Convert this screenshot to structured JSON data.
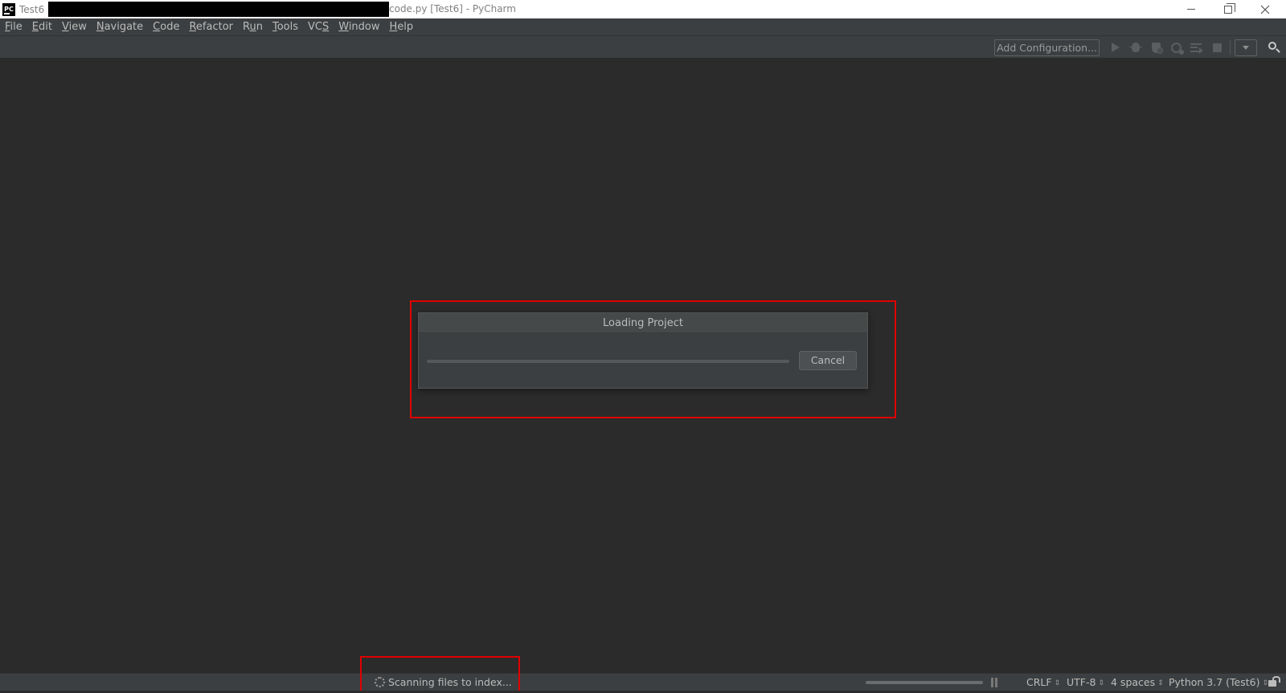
{
  "window": {
    "project_name": "Test6",
    "title_rest": "code.py [Test6] - PyCharm",
    "logo_text": "PC"
  },
  "menu": [
    {
      "label": "File",
      "mnemonic": "F",
      "rest": "ile"
    },
    {
      "label": "Edit",
      "mnemonic": "E",
      "rest": "dit"
    },
    {
      "label": "View",
      "mnemonic": "V",
      "rest": "iew"
    },
    {
      "label": "Navigate",
      "mnemonic": "N",
      "rest": "avigate"
    },
    {
      "label": "Code",
      "mnemonic": "C",
      "rest": "ode"
    },
    {
      "label": "Refactor",
      "mnemonic": "R",
      "rest": "efactor"
    },
    {
      "label": "Run",
      "mnemonic": "u",
      "pre": "R",
      "rest": "n"
    },
    {
      "label": "Tools",
      "mnemonic": "T",
      "rest": "ools"
    },
    {
      "label": "VCS",
      "mnemonic": "S",
      "pre": "VC",
      "rest": ""
    },
    {
      "label": "Window",
      "mnemonic": "W",
      "rest": "indow"
    },
    {
      "label": "Help",
      "mnemonic": "H",
      "rest": "elp"
    }
  ],
  "toolbar": {
    "add_configuration_label": "Add Configuration...",
    "icons": [
      "run-icon",
      "debug-icon",
      "coverage-icon",
      "profile-icon",
      "concurrency-icon",
      "stop-icon"
    ]
  },
  "dialog": {
    "title": "Loading Project",
    "cancel_label": "Cancel",
    "progress": 0.0
  },
  "status": {
    "message": "Scanning files to index...",
    "progress": 0.0,
    "line_separator": "CRLF",
    "encoding": "UTF-8",
    "indent": "4 spaces",
    "interpreter": "Python 3.7 (Test6)"
  },
  "colors": {
    "background": "#2b2b2b",
    "panel": "#3c3f41",
    "highlight": "#e00000"
  }
}
